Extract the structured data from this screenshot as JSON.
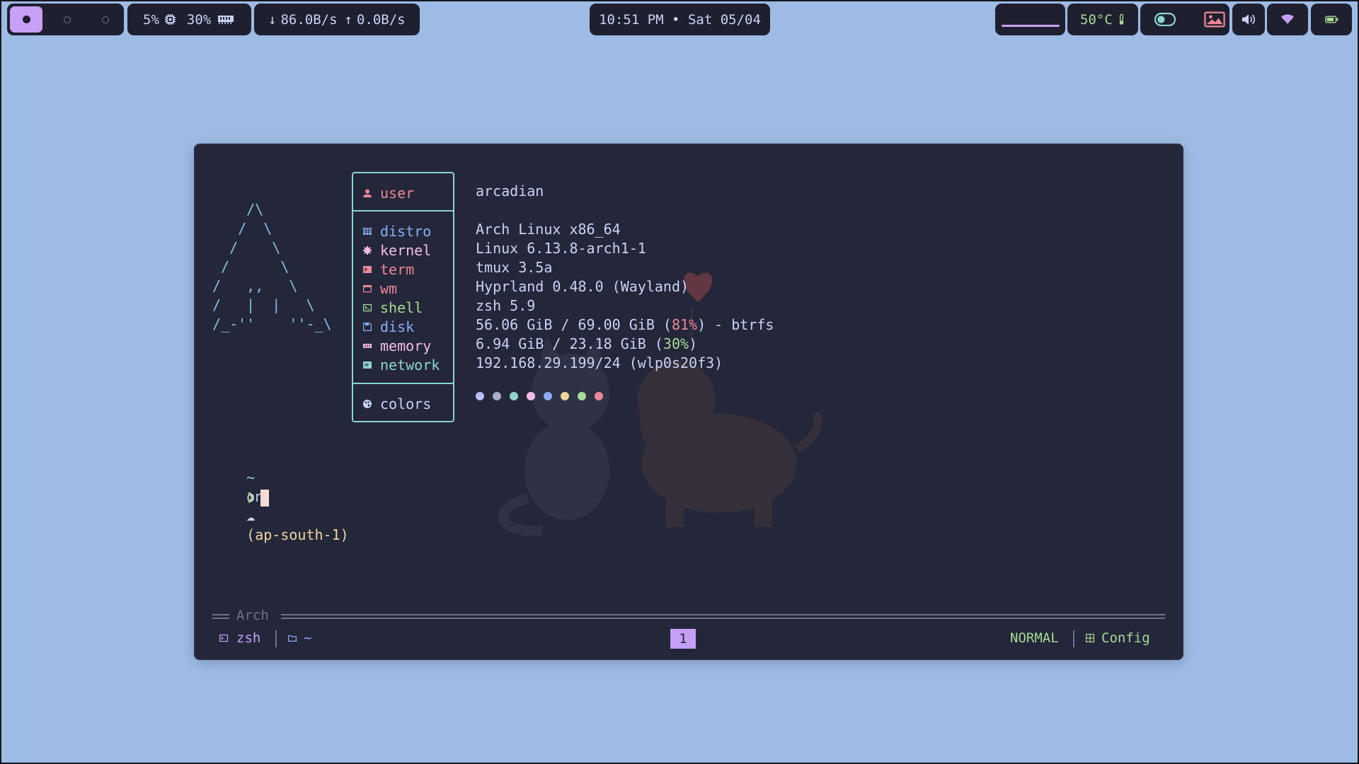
{
  "topbar": {
    "cpu": "5%",
    "ram": "30%",
    "net_down": "86.0B/s",
    "net_up": "0.0B/s",
    "clock": "10:51 PM • Sat 05/04",
    "temp": "50°C"
  },
  "fetch": {
    "ascii": "    /\\\n   /  \\\n  /    \\\n /      \\\n/   ,,   \\\n/   |  |   \\\n/_-''    ''-_\\",
    "labels": {
      "user": "user",
      "distro": "distro",
      "kernel": "kernel",
      "term": "term",
      "wm": "wm",
      "shell": "shell",
      "disk": "disk",
      "memory": "memory",
      "network": "network",
      "colors": "colors"
    },
    "values": {
      "user": "arcadian",
      "distro": "Arch Linux x86_64",
      "kernel": "Linux 6.13.8-arch1-1",
      "term": "tmux 3.5a",
      "wm": "Hyprland 0.48.0 (Wayland)",
      "shell": "zsh 5.9",
      "disk_used": "56.06 GiB / 69.00 GiB (",
      "disk_pct": "81%",
      "disk_rest": ") - btrfs",
      "memory_used": "6.94 GiB / 23.18 GiB (",
      "memory_pct": "30%",
      "memory_rest": ")",
      "network": "192.168.29.199/24 (wlp0s20f3)"
    },
    "palette": [
      "#b7bdf8",
      "#a5adcb",
      "#8bd5ca",
      "#f5bde6",
      "#8aadf4",
      "#eed49f",
      "#a6da95",
      "#ed8796"
    ]
  },
  "prompt": {
    "dir": "~",
    "on": "on",
    "region": "(ap-south-1)",
    "symbol": "❯"
  },
  "status": {
    "pane_title": "Arch",
    "shell": "zsh",
    "path": "~",
    "tab": "1",
    "mode": "NORMAL",
    "config": "Config"
  },
  "colors": {
    "bg": "#9dbbe5",
    "bar": "#1e2030",
    "terminal": "#24273a",
    "accent": "#c6a0f6",
    "teal": "#8bd5ca",
    "pink": "#f5bde6",
    "red": "#ed8796",
    "green": "#a6da95",
    "yellow": "#eed49f",
    "blue": "#8aadf4",
    "text": "#cad3f5"
  }
}
